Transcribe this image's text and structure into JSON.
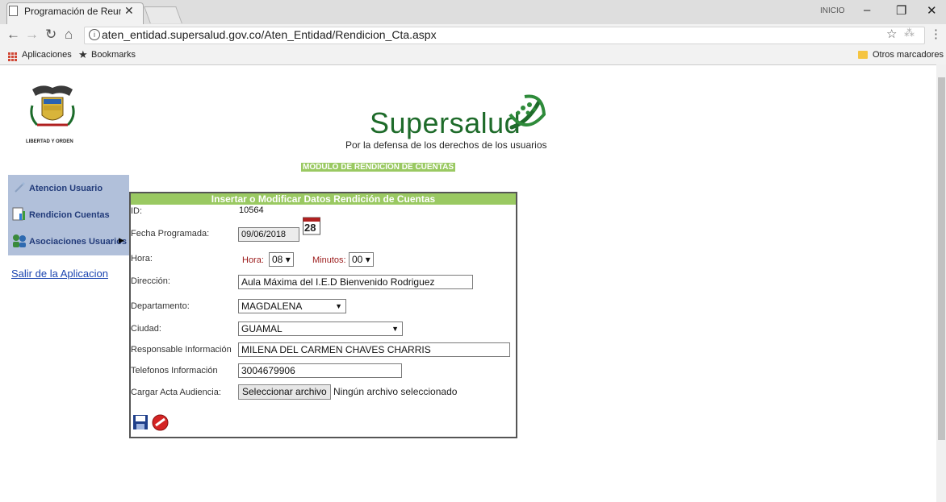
{
  "browser": {
    "tab_title": "Programación de Reunio",
    "tab_close": "✕",
    "user": "INICIO",
    "url": "aten_entidad.supersalud.gov.co/Aten_Entidad/Rendicion_Cta.aspx",
    "bookmarks": [
      "Aplicaciones",
      "Bookmarks"
    ],
    "other_bookmarks": "Otros marcadores"
  },
  "logo": {
    "shield_caption": "LIBERTAD Y ORDEN",
    "brand": "Supersalud",
    "tagline": "Por la defensa de los derechos de los usuarios"
  },
  "module_title": "MODULO DE RENDICION DE CUENTAS",
  "sidebar": {
    "items": [
      {
        "label": "Atencion Usuario"
      },
      {
        "label": "Rendicion Cuentas"
      },
      {
        "label": "Asociaciones Usuarios"
      }
    ],
    "exit": "Salir de la Aplicacion"
  },
  "form": {
    "title": "Insertar o Modificar Datos Rendición de Cuentas",
    "id_label": "ID:",
    "id_value": "10564",
    "fecha_label": "Fecha Programada:",
    "fecha_value": "09/06/2018",
    "calendar_day": "28",
    "hora_label": "Hora:",
    "hora_inner_label": "Hora:",
    "hora_value": "08",
    "minutos_label": "Minutos:",
    "minutos_value": "00",
    "direccion_label": "Dirección:",
    "direccion_value": "Aula Máxima del I.E.D Bienvenido Rodriguez",
    "departamento_label": "Departamento:",
    "departamento_value": "MAGDALENA",
    "ciudad_label": "Ciudad:",
    "ciudad_value": "GUAMAL",
    "responsable_label": "Responsable Información",
    "responsable_value": "MILENA DEL CARMEN CHAVES CHARRIS",
    "telefonos_label": "Telefonos Información",
    "telefonos_value": "3004679906",
    "acta_label": "Cargar Acta Audiencia:",
    "file_button": "Seleccionar archivo",
    "file_status": "Ningún archivo seleccionado"
  },
  "colors": {
    "accent_green": "#9ac962",
    "brand_green": "#1e6b2a",
    "menu_blue": "#b1c0da"
  }
}
